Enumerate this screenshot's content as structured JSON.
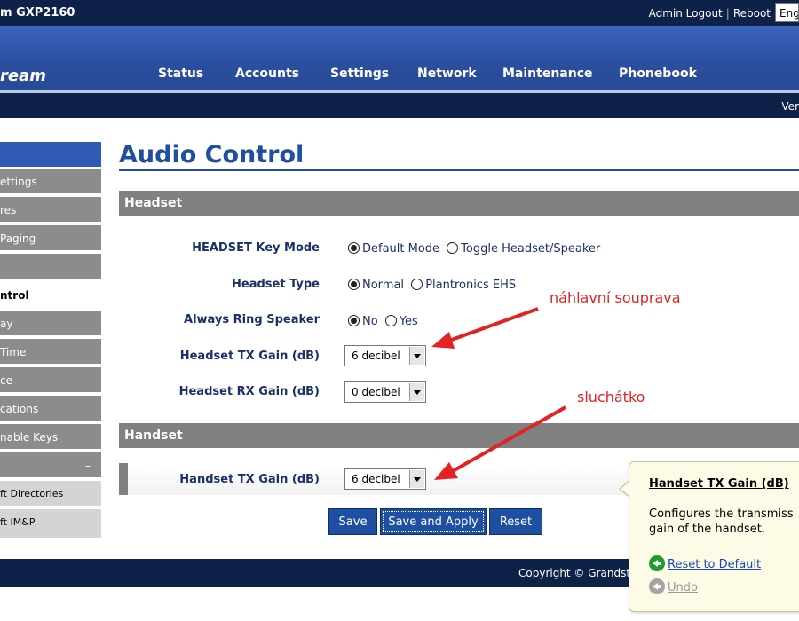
{
  "header": {
    "title": "m GXP2160",
    "admin_logout": "Admin Logout",
    "separator": "|",
    "reboot": "Reboot",
    "language": "Eng"
  },
  "nav": {
    "logo": "ream",
    "items": [
      "Status",
      "Accounts",
      "Settings",
      "Network",
      "Maintenance",
      "Phonebook"
    ]
  },
  "version_bar": {
    "text": "Ver"
  },
  "sidebar": {
    "items": [
      {
        "label": "ettings"
      },
      {
        "label": "res"
      },
      {
        "label": "Paging"
      },
      {
        "label": ""
      },
      {
        "label": "ntrol"
      },
      {
        "label": "ay"
      },
      {
        "label": "Time"
      },
      {
        "label": "ce"
      },
      {
        "label": "cations"
      },
      {
        "label": "nable Keys"
      },
      {
        "label": "",
        "toggle": "–"
      },
      {
        "label": "ft Directories"
      },
      {
        "label": "ft IM&P"
      }
    ]
  },
  "page": {
    "title": "Audio Control",
    "headset_section": "Headset",
    "handset_section": "Handset",
    "headset_key_mode": {
      "label": "HEADSET Key Mode",
      "options": [
        "Default Mode",
        "Toggle Headset/Speaker"
      ],
      "selected": 0
    },
    "headset_type": {
      "label": "Headset Type",
      "options": [
        "Normal",
        "Plantronics EHS"
      ],
      "selected": 0
    },
    "always_ring_speaker": {
      "label": "Always Ring Speaker",
      "options": [
        "No",
        "Yes"
      ],
      "selected": 0
    },
    "headset_tx_gain": {
      "label": "Headset TX Gain (dB)",
      "value": "6 decibel"
    },
    "headset_rx_gain": {
      "label": "Headset RX Gain (dB)",
      "value": "0 decibel"
    },
    "handset_tx_gain": {
      "label": "Handset TX Gain (dB)",
      "value": "6 decibel"
    }
  },
  "buttons": {
    "save": "Save",
    "save_apply": "Save and Apply",
    "reset": "Reset"
  },
  "footer": {
    "copyright": "Copyright © Grandstr"
  },
  "tooltip": {
    "title": "Handset TX Gain (dB)",
    "description_lines": [
      "Configures the transmiss",
      "gain of the handset."
    ],
    "reset_default": "Reset to Default",
    "undo": "Undo"
  },
  "annotations": {
    "headset": "náhlavní souprava",
    "handset": "sluchátko"
  },
  "colors": {
    "top_bar": "#0d2149",
    "nav_blue": "#2b4f9e",
    "accent_heading": "#1f4f9e",
    "section_gray": "#808080",
    "button_blue": "#1f4fa0",
    "annotation_red": "#e32222",
    "tooltip_bg": "#fdfbe6",
    "reset_icon": "#1e9c2d",
    "undo_icon": "#a5a5a5"
  },
  "icons": {
    "reset": "reset-default-icon",
    "undo": "undo-icon",
    "select_arrow": "chevron-down-icon"
  }
}
